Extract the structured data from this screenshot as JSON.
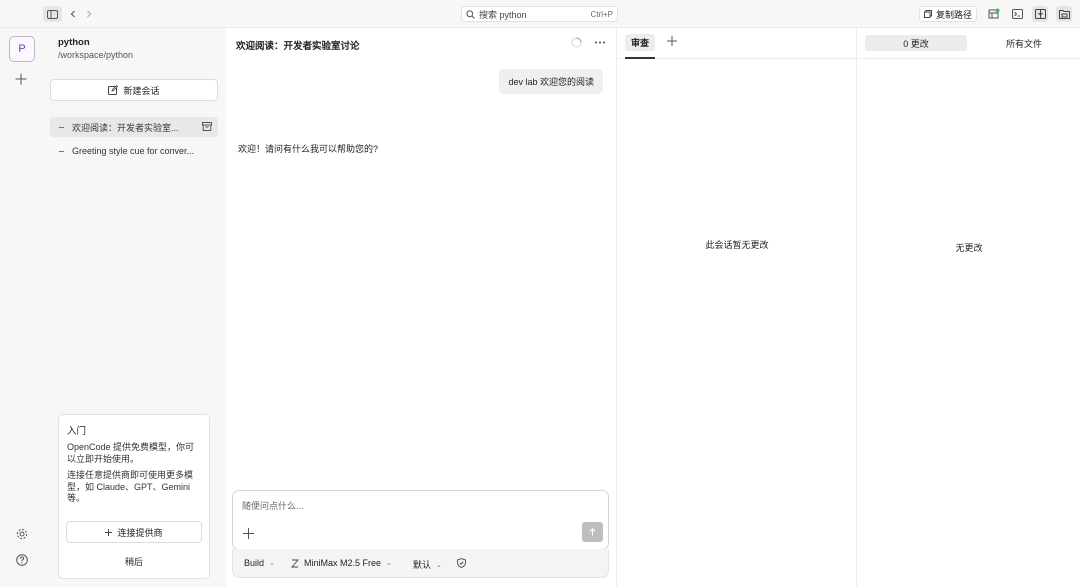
{
  "search": {
    "placeholder": "搜索 python",
    "shortcut": "Ctrl+P"
  },
  "topbar": {
    "copy_path_label": "复制路径",
    "status_color": "#3cc35a"
  },
  "rail": {
    "project_initial": "P"
  },
  "project": {
    "name": "python",
    "path": "/workspace/python"
  },
  "sidebar": {
    "new_session_label": "新建会话",
    "sessions": [
      {
        "title": "欢迎阅读：开发者实验室...",
        "active": true
      },
      {
        "title": "Greeting style cue for conver...",
        "active": false
      }
    ]
  },
  "guide": {
    "title": "入门",
    "p1": "OpenCode 提供免费模型，你可以立即开始使用。",
    "p2": "连接任意提供商即可使用更多模型，如 Claude、GPT、Gemini 等。",
    "connect_label": "连接提供商",
    "later_label": "稍后"
  },
  "chat": {
    "title": "欢迎阅读：开发者实验室讨论",
    "messages": [
      {
        "role": "user",
        "text": "dev lab 欢迎您的阅读"
      },
      {
        "role": "assistant",
        "text": "欢迎！请问有什么我可以帮助您的?"
      }
    ],
    "input_placeholder": "随便问点什么...",
    "mode_label": "Build",
    "model_label": "MiniMax M2.5 Free",
    "variant_label": "默认"
  },
  "review": {
    "tab_label": "审查",
    "empty_text": "此会话暂无更改"
  },
  "files": {
    "changes_tab": "0 更改",
    "all_files_tab": "所有文件",
    "empty_text": "无更改"
  }
}
